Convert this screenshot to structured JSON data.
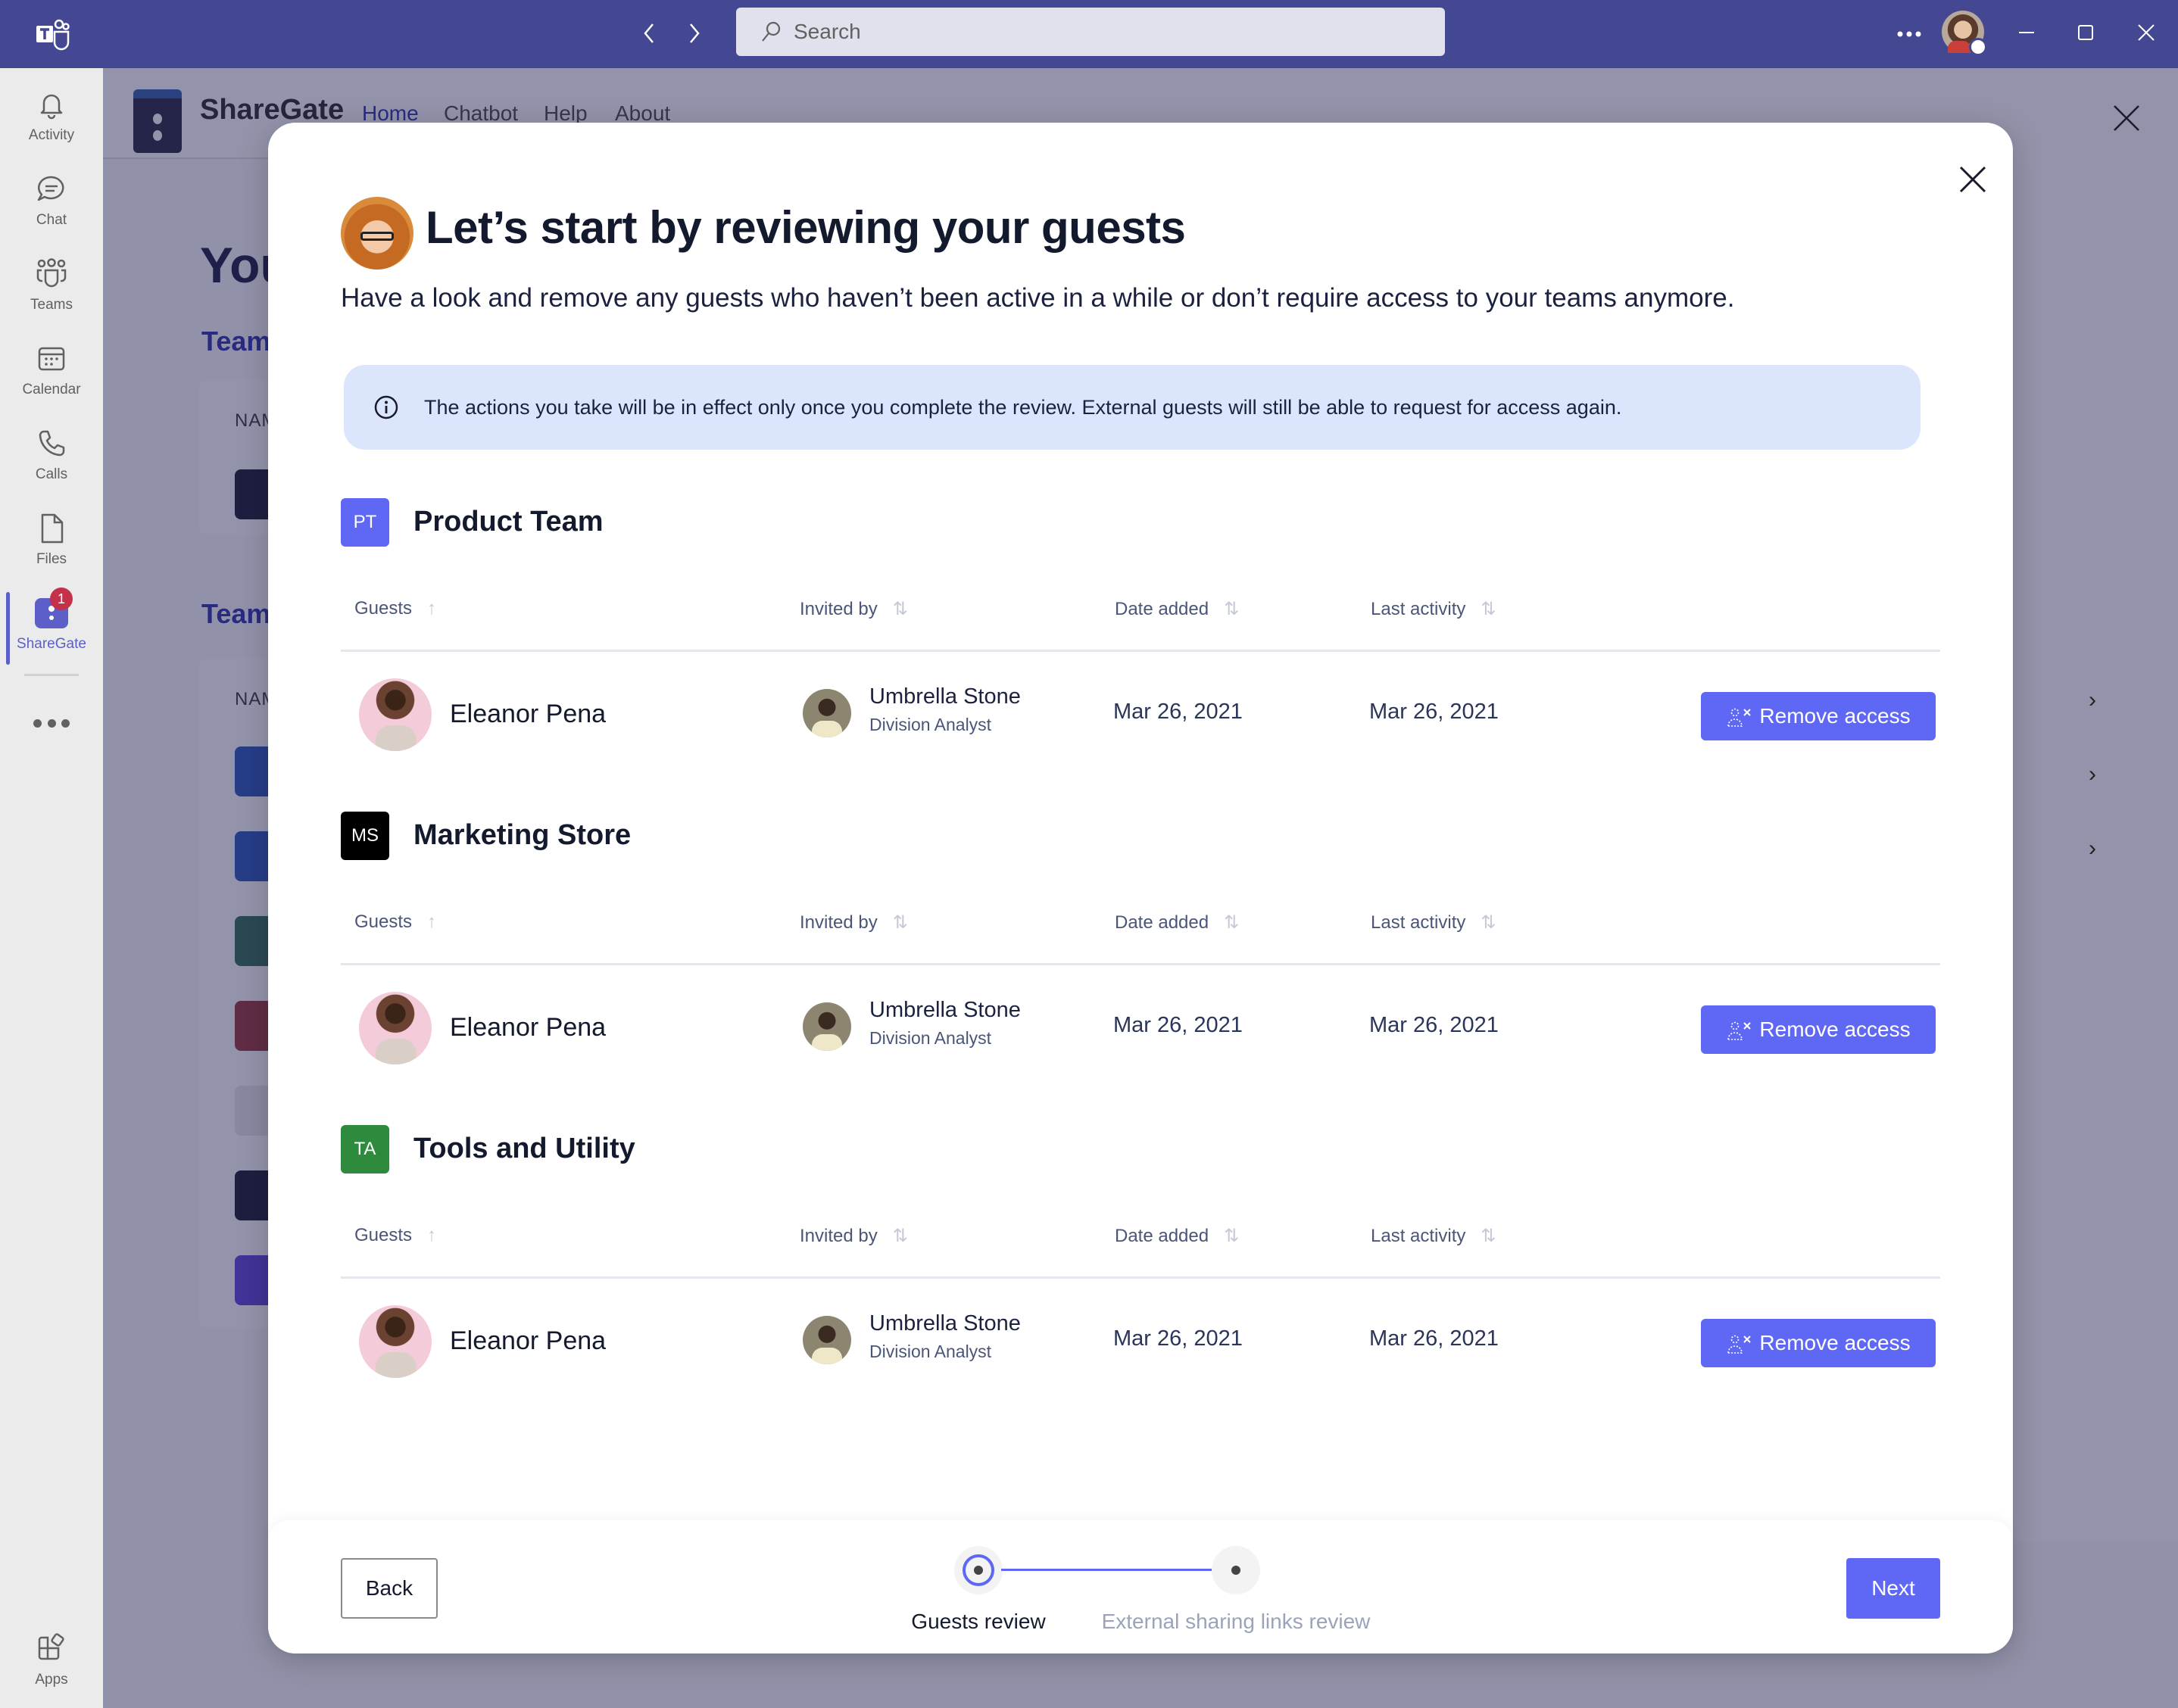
{
  "titlebar": {
    "search_placeholder": "Search",
    "more_label": "•••"
  },
  "rail": {
    "items": [
      {
        "label": "Activity",
        "icon": "bell-icon"
      },
      {
        "label": "Chat",
        "icon": "chat-icon"
      },
      {
        "label": "Teams",
        "icon": "teams-icon"
      },
      {
        "label": "Calendar",
        "icon": "calendar-icon"
      },
      {
        "label": "Calls",
        "icon": "phone-icon"
      },
      {
        "label": "Files",
        "icon": "file-icon"
      },
      {
        "label": "ShareGate",
        "icon": "sharegate-icon",
        "badge": "1",
        "active": true
      }
    ],
    "apps_label": "Apps"
  },
  "app": {
    "brand": "ShareGate",
    "nav": [
      "Home",
      "Chatbot",
      "Help",
      "About"
    ],
    "active_nav": "Home",
    "content_title": "You",
    "section_1": "Team",
    "section_2": "Team",
    "col_name": "NAM"
  },
  "modal": {
    "title": "Let’s start by reviewing your guests",
    "subtitle": "Have a look and remove any guests who haven’t been active in a while or don’t require access to your teams anymore.",
    "info": "The actions you take will be in effect only once you complete the review. External guests will still be able to request for access again.",
    "columns": {
      "guests": "Guests",
      "invited_by": "Invited by",
      "date_added": "Date added",
      "last_activity": "Last activity"
    },
    "teams": [
      {
        "initials": "PT",
        "name": "Product Team",
        "color": "#5f68f5",
        "guest": {
          "name": "Eleanor Pena",
          "invited_by": "Umbrella Stone",
          "invited_by_role": "Division Analyst",
          "date_added": "Mar 26, 2021",
          "last_activity": "Mar 26, 2021"
        },
        "action": "Remove access"
      },
      {
        "initials": "MS",
        "name": "Marketing Store",
        "color": "#000000",
        "guest": {
          "name": "Eleanor Pena",
          "invited_by": "Umbrella Stone",
          "invited_by_role": "Division Analyst",
          "date_added": "Mar 26, 2021",
          "last_activity": "Mar 26, 2021"
        },
        "action": "Remove access"
      },
      {
        "initials": "TA",
        "name": "Tools and Utility",
        "color": "#2e8b3d",
        "guest": {
          "name": "Eleanor Pena",
          "invited_by": "Umbrella Stone",
          "invited_by_role": "Division Analyst",
          "date_added": "Mar 26, 2021",
          "last_activity": "Mar 26, 2021"
        },
        "action": "Remove access"
      }
    ],
    "footer": {
      "back": "Back",
      "next": "Next",
      "steps": [
        {
          "label": "Guests review",
          "active": true
        },
        {
          "label": "External sharing links review",
          "active": false
        }
      ]
    }
  },
  "colors": {
    "titlebar": "#444791",
    "accent": "#5f68f5",
    "info_bg": "#dbe5fc"
  }
}
